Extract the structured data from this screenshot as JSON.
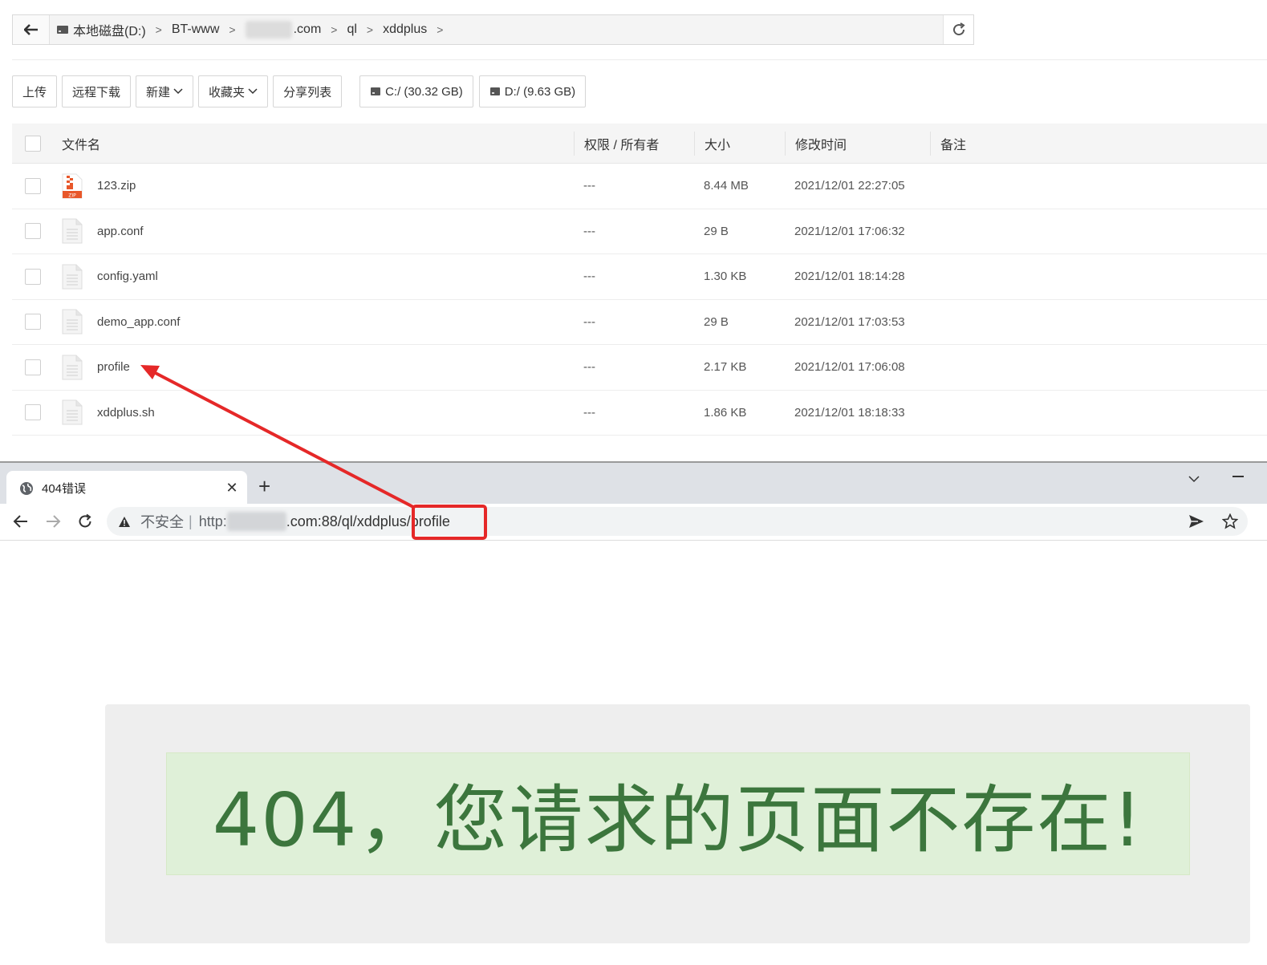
{
  "file_manager": {
    "breadcrumb": [
      "本地磁盘(D:)",
      "BT-www",
      ".com",
      "ql",
      "xddplus"
    ],
    "toolbar": {
      "upload": "上传",
      "remote_download": "远程下载",
      "new": "新建",
      "favorites": "收藏夹",
      "share_list": "分享列表",
      "drive_c": "C:/ (30.32 GB)",
      "drive_d": "D:/ (9.63 GB)"
    },
    "columns": {
      "name": "文件名",
      "perm": "权限 / 所有者",
      "size": "大小",
      "mtime": "修改时间",
      "note": "备注"
    },
    "files": [
      {
        "name": "123.zip",
        "perm": "---",
        "size": "8.44 MB",
        "mtime": "2021/12/01 22:27:05",
        "icon": "zip-file-icon"
      },
      {
        "name": "app.conf",
        "perm": "---",
        "size": "29 B",
        "mtime": "2021/12/01 17:06:32",
        "icon": "text-file-icon"
      },
      {
        "name": "config.yaml",
        "perm": "---",
        "size": "1.30 KB",
        "mtime": "2021/12/01 18:14:28",
        "icon": "text-file-icon"
      },
      {
        "name": "demo_app.conf",
        "perm": "---",
        "size": "29 B",
        "mtime": "2021/12/01 17:03:53",
        "icon": "text-file-icon"
      },
      {
        "name": "profile",
        "perm": "---",
        "size": "2.17 KB",
        "mtime": "2021/12/01 17:06:08",
        "icon": "text-file-icon"
      },
      {
        "name": "xddplus.sh",
        "perm": "---",
        "size": "1.86 KB",
        "mtime": "2021/12/01 18:18:33",
        "icon": "text-file-icon"
      }
    ]
  },
  "browser": {
    "tab_title": "404错误",
    "new_tab_glyph": "+",
    "close_glyph": "✕",
    "address": {
      "insecure_label": "不安全",
      "pipe": "|",
      "scheme": "http:",
      "rest": ".com:88/ql/xddplus/profile"
    }
  },
  "page": {
    "error_message": "404，您请求的页面不存在!"
  },
  "colors": {
    "annotation_red": "#e52828",
    "error_green_text": "#3c763d",
    "error_green_bg": "#dff0d8"
  }
}
